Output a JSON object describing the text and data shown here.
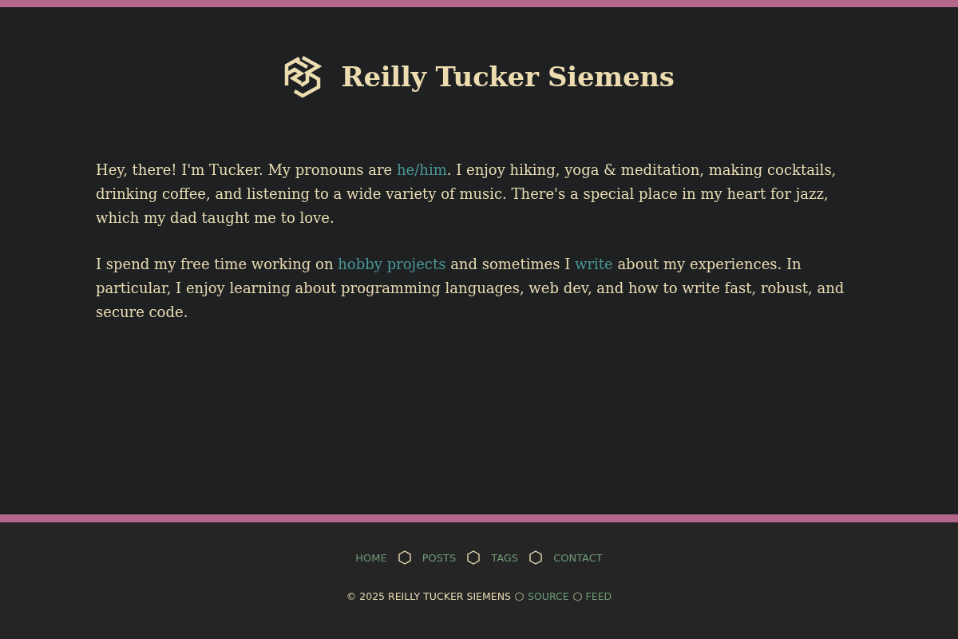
{
  "header": {
    "title": "Reilly Tucker Siemens"
  },
  "paragraphs": [
    {
      "parts": [
        {
          "kind": "text",
          "text": "Hey, there! I'm Tucker. My pronouns are "
        },
        {
          "kind": "link",
          "text": "he/him"
        },
        {
          "kind": "text",
          "text": ". I enjoy hiking, yoga & meditation, making cocktails, drinking coffee, and listening to a wide variety of music. There's a special place in my heart for jazz, which my dad taught me to love."
        }
      ]
    },
    {
      "parts": [
        {
          "kind": "text",
          "text": "I spend my free time working on "
        },
        {
          "kind": "link",
          "text": "hobby projects"
        },
        {
          "kind": "text",
          "text": " and sometimes I "
        },
        {
          "kind": "link",
          "text": "write"
        },
        {
          "kind": "text",
          "text": " about my experiences. In particular, I enjoy learning about programming languages, web dev, and how to write fast, robust, and secure code."
        }
      ]
    }
  ],
  "footer": {
    "nav": [
      {
        "label": "HOME"
      },
      {
        "label": "POSTS"
      },
      {
        "label": "TAGS"
      },
      {
        "label": "CONTACT"
      }
    ],
    "copyright": "© 2025 REILLY TUCKER SIEMENS",
    "links": [
      {
        "label": "SOURCE"
      },
      {
        "label": "FEED"
      }
    ]
  }
}
